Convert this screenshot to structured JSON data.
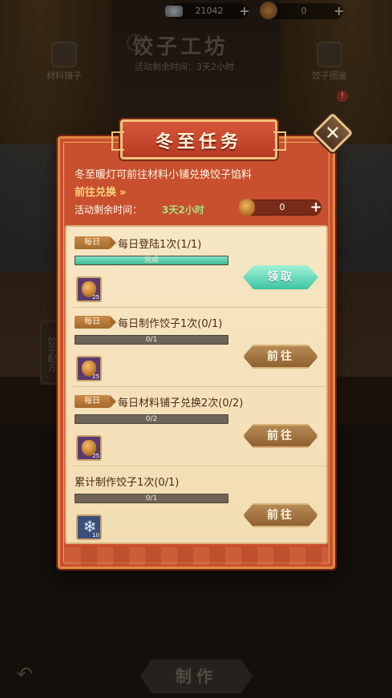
{
  "top_bar": {
    "silver_amount": "21042",
    "dumpling_amount": "0"
  },
  "background": {
    "title": "饺子工坊",
    "timer": "活动剩余时间：3天2小时",
    "materials_shop": "材料铺子",
    "dumpling_album": "饺子图鉴",
    "recipe": "饺子配方",
    "make_button": "制作",
    "badge": "!"
  },
  "modal": {
    "title": "冬至任务",
    "close_label": "✕",
    "description": "冬至暖灯可前往材料小铺兑换饺子馅料",
    "goto_link": "前往兑换",
    "goto_chevron": "»",
    "remaining_label": "活动剩余时间：",
    "remaining_value": "3天2小时",
    "counter_value": "0"
  },
  "tasks": [
    {
      "tag": "每日",
      "text": "每日登陆1次(1/1)",
      "progress_text": "完成",
      "progress": 1.0,
      "reward_qty": "25",
      "reward_icon": "lantern-icon",
      "action": "领取",
      "action_type": "claim"
    },
    {
      "tag": "每日",
      "text": "每日制作饺子1次(0/1)",
      "progress_text": "0/1",
      "progress": 0.0,
      "reward_qty": "25",
      "reward_icon": "lantern-icon",
      "action": "前往",
      "action_type": "go"
    },
    {
      "tag": "每日",
      "text": "每日材料铺子兑换2次(0/2)",
      "progress_text": "0/2",
      "progress": 0.0,
      "reward_qty": "25",
      "reward_icon": "lantern-icon",
      "action": "前往",
      "action_type": "go"
    },
    {
      "tag": "",
      "text": "累计制作饺子1次(0/1)",
      "progress_text": "0/1",
      "progress": 0.0,
      "reward_qty": "10",
      "reward_icon": "snowflake-icon",
      "action": "前往",
      "action_type": "go"
    }
  ]
}
